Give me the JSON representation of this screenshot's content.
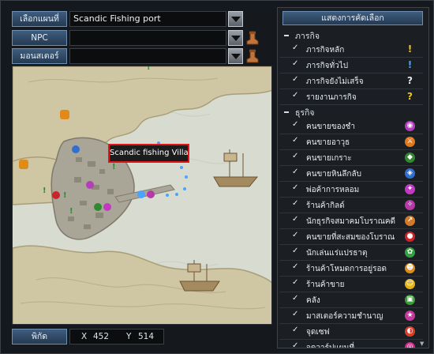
{
  "selectors": [
    {
      "label": "เลือกแผนที่",
      "value": "Scandic Fishing port"
    },
    {
      "label": "NPC",
      "value": ""
    },
    {
      "label": "มอนสเตอร์",
      "value": ""
    }
  ],
  "map": {
    "tooltip": "Scandic fishing Village"
  },
  "coords": {
    "label": "พิกัด",
    "x_label": "X",
    "x_value": "452",
    "y_label": "Y",
    "y_value": "514"
  },
  "panel": {
    "title": "แสดงการคัดเลือก",
    "categories": [
      {
        "label": "ภารกิจ",
        "items": [
          {
            "label": "ภารกิจหลัก",
            "icon": "exclamation-yellow",
            "color": "#f0c419",
            "glyph": "!"
          },
          {
            "label": "ภารกิจทั่วไป",
            "icon": "exclamation-blue",
            "color": "#4aa3ff",
            "glyph": "!"
          },
          {
            "label": "ภารกิจยังไม่เสร็จ",
            "icon": "question-white",
            "color": "#e6e6e6",
            "glyph": "?"
          },
          {
            "label": "รายงานภารกิจ",
            "icon": "question-yellow",
            "color": "#f0c419",
            "glyph": "?"
          }
        ]
      },
      {
        "label": "ธุรกิจ",
        "items": [
          {
            "label": "คนขายของชำ",
            "icon": "grocery-icon",
            "color": "#b23fb8",
            "glyph": "◉"
          },
          {
            "label": "คนขายอาวุธ",
            "icon": "weapon-shop-icon",
            "color": "#e07a1f",
            "glyph": "⚔"
          },
          {
            "label": "คนขายเกราะ",
            "icon": "armor-shop-icon",
            "color": "#2f8a2f",
            "glyph": "◆"
          },
          {
            "label": "คนขายหินลึกลับ",
            "icon": "mystic-stone-icon",
            "color": "#2f6fd0",
            "glyph": "◈"
          },
          {
            "label": "พ่อค้าการหลอม",
            "icon": "smelting-icon",
            "color": "#c03bc0",
            "glyph": "✦"
          },
          {
            "label": "ร้านค้ากิลด์",
            "icon": "guild-shop-icon",
            "color": "#b43aa8",
            "glyph": "✧"
          },
          {
            "label": "นักธุรกิจสมาคมโบราณคดี",
            "icon": "archaeology-icon",
            "color": "#d17a2a",
            "glyph": "↗"
          },
          {
            "label": "คนขายที่สะสมของโบราณ",
            "icon": "antique-icon",
            "color": "#c9252c",
            "glyph": "●"
          },
          {
            "label": "นักเล่นแร่แปรธาตุ",
            "icon": "alchemist-icon",
            "color": "#35a043",
            "glyph": "✿"
          },
          {
            "label": "ร้านค้าโหมดการอยู่รอด",
            "icon": "survival-shop-icon",
            "color": "#e08a1a",
            "glyph": "☻"
          },
          {
            "label": "ร้านค้าขาย",
            "icon": "sell-shop-icon",
            "color": "#e0b21a",
            "glyph": "☺"
          },
          {
            "label": "คลัง",
            "icon": "storage-icon",
            "color": "#3c9a3c",
            "glyph": "▣"
          },
          {
            "label": "มาสเตอร์ความชำนาญ",
            "icon": "mastery-icon",
            "color": "#c33a9d",
            "glyph": "★"
          },
          {
            "label": "จุดเซฟ",
            "icon": "save-point-icon",
            "color": "#d6402a",
            "glyph": "◐"
          },
          {
            "label": "จุดวาร์ปแผนที่",
            "icon": "warp-point-icon",
            "color": "#cf2a8c",
            "glyph": "◎"
          }
        ]
      }
    ]
  },
  "colors": {
    "sea": "#d7dbd0",
    "land": "#cfc6a4",
    "land_dark": "#b8ad86",
    "town": "#a9a597",
    "highlight": "#e0161b"
  }
}
